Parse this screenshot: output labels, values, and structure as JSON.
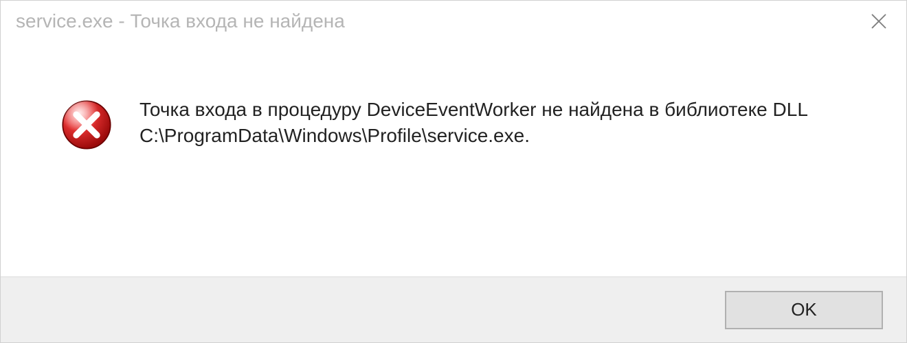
{
  "titlebar": {
    "title": "service.exe - Точка входа не найдена"
  },
  "message": {
    "text": "Точка входа в процедуру DeviceEventWorker не найдена в библиотеке DLL C:\\ProgramData\\Windows\\Profile\\service.exe."
  },
  "buttons": {
    "ok_label": "OK"
  }
}
